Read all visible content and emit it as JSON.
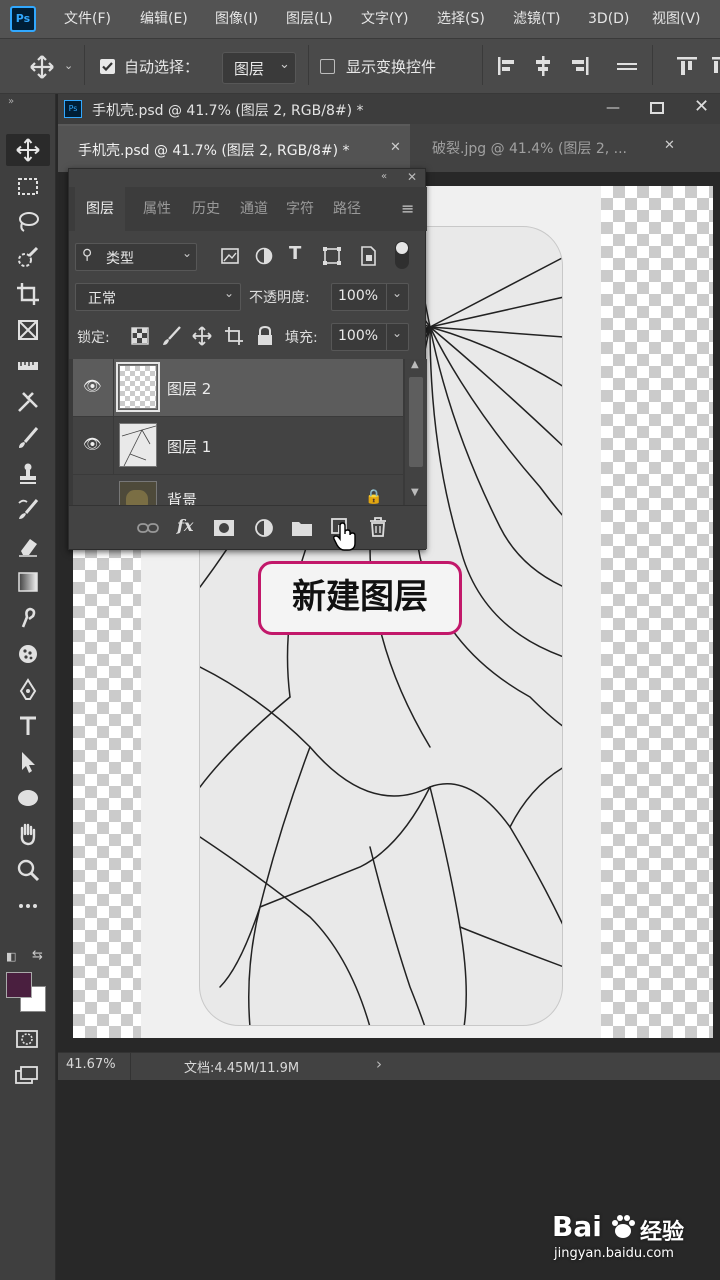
{
  "menubar": {
    "logo": "Ps",
    "items": [
      "文件(F)",
      "编辑(E)",
      "图像(I)",
      "图层(L)",
      "文字(Y)",
      "选择(S)",
      "滤镜(T)",
      "3D(D)",
      "视图(V)"
    ]
  },
  "options": {
    "auto_select_label": "自动选择：",
    "auto_select_checked": true,
    "target_select": "图层",
    "show_transform_label": "显示变换控件",
    "show_transform_checked": false
  },
  "document": {
    "window_title": "手机壳.psd @ 41.7% (图层 2, RGB/8#) *",
    "tabs": [
      {
        "label": "手机壳.psd @ 41.7% (图层 2, RGB/8#) *",
        "active": true
      },
      {
        "label": "破裂.jpg @ 41.4% (图层 2, ...",
        "active": false
      }
    ]
  },
  "layers_panel": {
    "tabs": [
      "图层",
      "属性",
      "历史",
      "通道",
      "字符",
      "路径"
    ],
    "filter_kind": "类型",
    "blend_mode": "正常",
    "opacity_label": "不透明度:",
    "opacity_value": "100%",
    "lock_label": "锁定:",
    "fill_label": "填充:",
    "fill_value": "100%",
    "layers": [
      {
        "name": "图层 2",
        "visible": true,
        "selected": true
      },
      {
        "name": "图层 1",
        "visible": true,
        "selected": false
      },
      {
        "name": "背景",
        "visible": false,
        "selected": false
      }
    ],
    "footer_icons": [
      "link-icon",
      "fx-icon",
      "mask-icon",
      "adjustment-icon",
      "group-folder-icon",
      "new-layer-icon",
      "trash-icon"
    ]
  },
  "callout": {
    "text": "新建图层"
  },
  "statusbar": {
    "zoom": "41.67%",
    "doc_info": "文档:4.45M/11.9M",
    "arrow": "›"
  },
  "colors": {
    "foreground": "#4a1f3f",
    "background": "#ffffff",
    "callout_border": "#c2186a"
  },
  "watermark": {
    "brand": "Bai",
    "brand_cn": "经验",
    "url": "jingyan.baidu.com"
  }
}
